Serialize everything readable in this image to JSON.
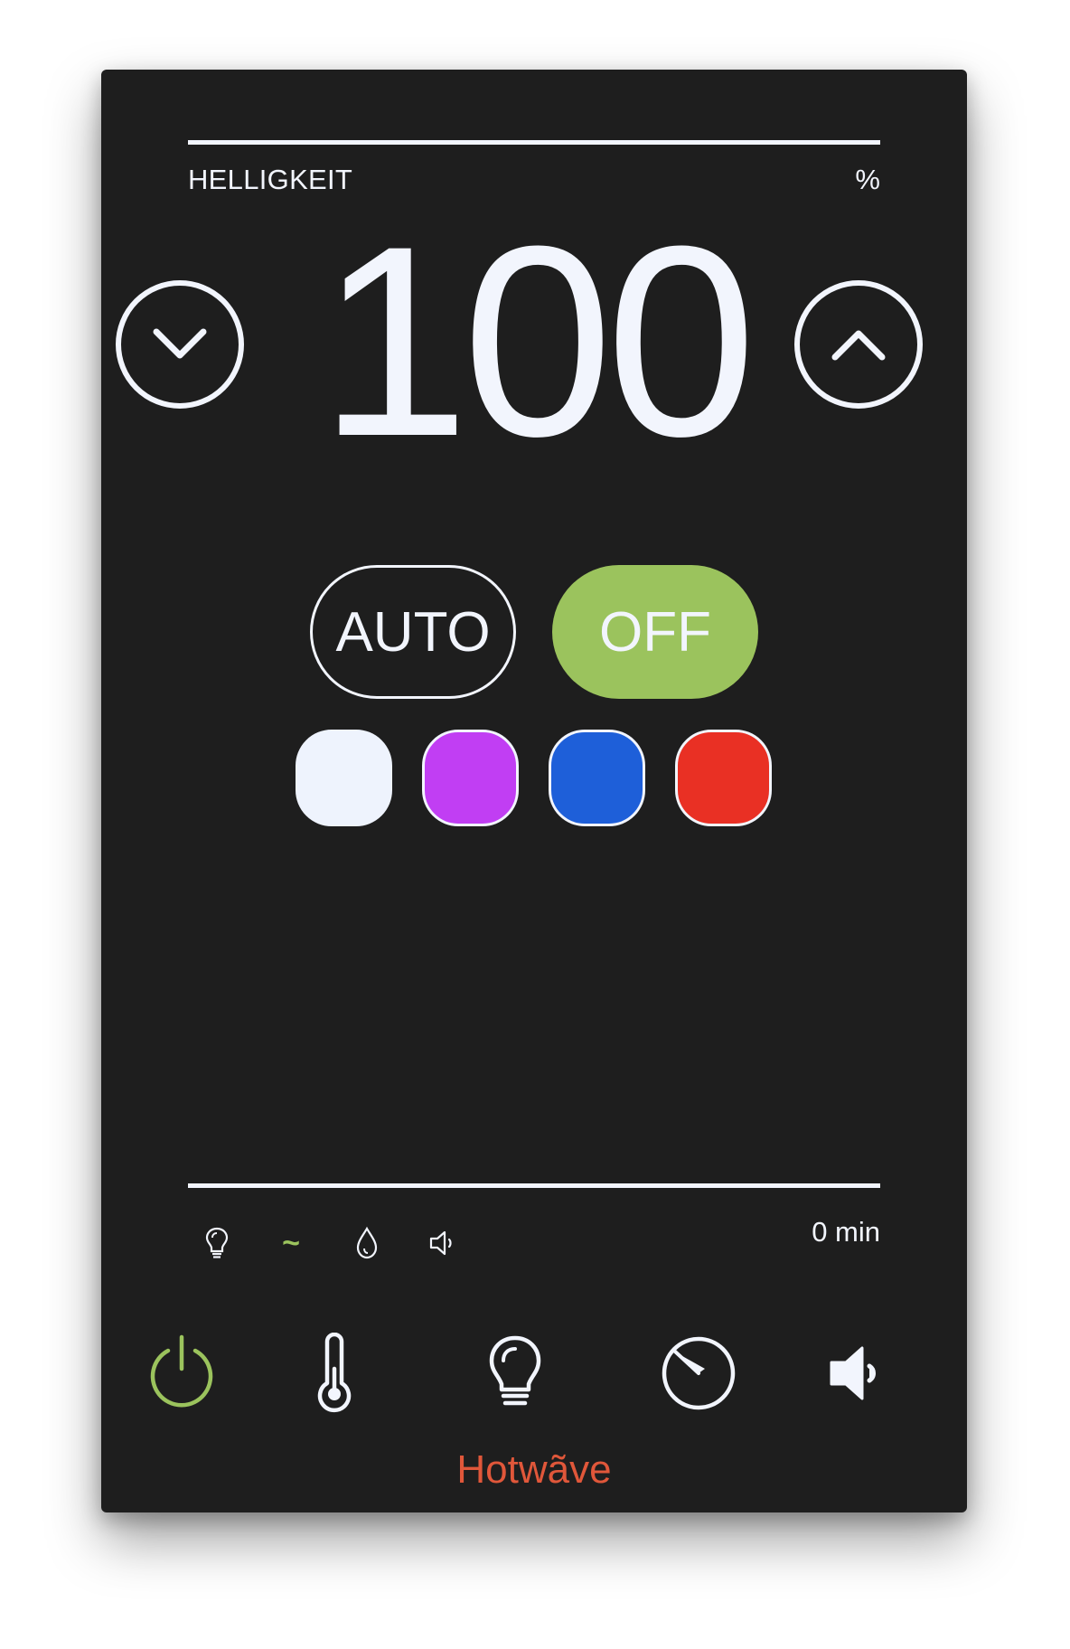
{
  "display": {
    "label": "HELLIGKEIT",
    "unit": "%",
    "value": "100"
  },
  "controls": {
    "decrease_icon": "chevron-down-icon",
    "increase_icon": "chevron-up-icon"
  },
  "modes": {
    "auto_label": "AUTO",
    "off_label": "OFF",
    "active": "OFF"
  },
  "colors": {
    "accent": "#9bc35d",
    "brand": "#e0573a",
    "panel": "#1e1e1e",
    "foreground": "#f2f5fd",
    "swatches": [
      {
        "name": "white",
        "hex": "#eef3fd",
        "selected": true
      },
      {
        "name": "purple",
        "hex": "#c13ef3",
        "selected": false
      },
      {
        "name": "blue",
        "hex": "#1e5fd9",
        "selected": false
      },
      {
        "name": "red",
        "hex": "#e93024",
        "selected": false
      }
    ]
  },
  "status": {
    "icons": [
      "bulb-icon",
      "wave-icon",
      "drop-icon",
      "speaker-icon"
    ],
    "wave_glyph": "~",
    "timer": "0 min"
  },
  "nav": {
    "items": [
      {
        "icon": "power-icon",
        "active": true
      },
      {
        "icon": "thermometer-icon",
        "active": false
      },
      {
        "icon": "bulb-icon",
        "active": false
      },
      {
        "icon": "timer-icon",
        "active": false
      },
      {
        "icon": "speaker-icon",
        "active": false
      }
    ]
  },
  "brand": {
    "name": "Hotwãve"
  }
}
